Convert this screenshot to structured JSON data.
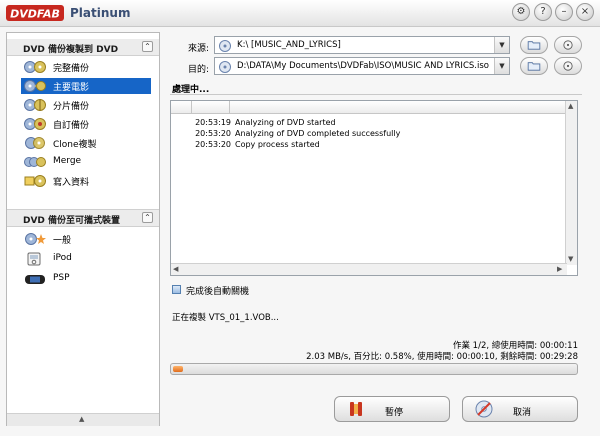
{
  "app": {
    "logo_text": "DVDFAB",
    "edition": "Platinum",
    "accent_color": "#1665c7"
  },
  "title_buttons": [
    {
      "name": "settings-icon",
      "glyph": "⚙"
    },
    {
      "name": "help-icon",
      "glyph": "?"
    },
    {
      "name": "minimize-icon",
      "glyph": "–"
    },
    {
      "name": "close-icon",
      "glyph": "×"
    }
  ],
  "sidebar": {
    "section1": {
      "title": "DVD 備份複製到 DVD",
      "items": [
        {
          "label": "完整備份",
          "icon": "full-disc-icon",
          "selected": false
        },
        {
          "label": "主要電影",
          "icon": "main-movie-icon",
          "selected": true
        },
        {
          "label": "分片備份",
          "icon": "split-icon",
          "selected": false
        },
        {
          "label": "自訂備份",
          "icon": "customize-icon",
          "selected": false
        },
        {
          "label": "Clone複製",
          "icon": "clone-icon",
          "selected": false
        },
        {
          "label": "Merge",
          "icon": "merge-icon",
          "selected": false
        },
        {
          "label": "寫入資料",
          "icon": "write-data-icon",
          "selected": false
        }
      ]
    },
    "section2": {
      "title": "DVD 備份至可攜式裝置",
      "items": [
        {
          "label": "一般",
          "icon": "generic-device-icon"
        },
        {
          "label": "iPod",
          "icon": "ipod-icon"
        },
        {
          "label": "PSP",
          "icon": "psp-icon"
        }
      ]
    }
  },
  "source": {
    "label": "來源:",
    "value": "K:\\ [MUSIC_AND_LYRICS]"
  },
  "target": {
    "label": "目的:",
    "value": "D:\\DATA\\My Documents\\DVDFab\\ISO\\MUSIC AND LYRICS.iso"
  },
  "processing_title": "處理中...",
  "log": [
    {
      "time": "20:53:19",
      "message": "Analyzing of DVD started"
    },
    {
      "time": "20:53:20",
      "message": "Analyzing of DVD completed successfully"
    },
    {
      "time": "20:53:20",
      "message": "Copy process started"
    }
  ],
  "auto_shutdown_label": "完成後自動關機",
  "copying_text": "正在複製 VTS_01_1.VOB...",
  "status_line1": "作業 1/2, 總使用時間: 00:00:11",
  "status_line2": "2.03 MB/s, 百分比: 0.58%, 使用時間: 00:00:10, 剩餘時間: 00:29:28",
  "progress": {
    "percent": 0.58
  },
  "buttons": {
    "pause": "暫停",
    "cancel": "取消"
  }
}
